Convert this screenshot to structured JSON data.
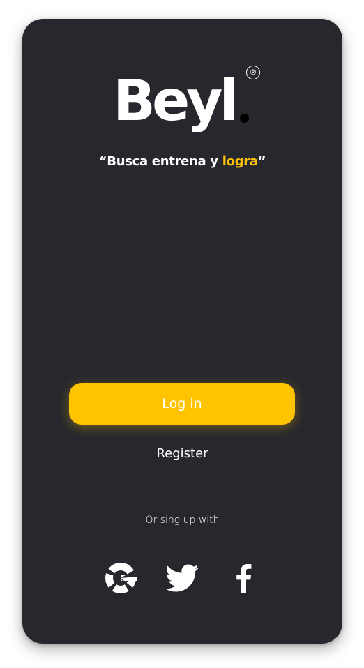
{
  "brand": {
    "logo_text": "Beyl",
    "registered_mark": "®"
  },
  "tagline": {
    "open_quote": "“",
    "prefix": "Busca entrena y ",
    "accent": "logra",
    "close_quote": "”"
  },
  "actions": {
    "login_label": "Log in",
    "register_label": "Register"
  },
  "social": {
    "prompt": "Or sing up with",
    "providers": [
      "google-icon",
      "twitter-icon",
      "facebook-icon"
    ]
  },
  "colors": {
    "background": "#27282d",
    "accent": "#ffc300",
    "text": "#ffffff"
  }
}
